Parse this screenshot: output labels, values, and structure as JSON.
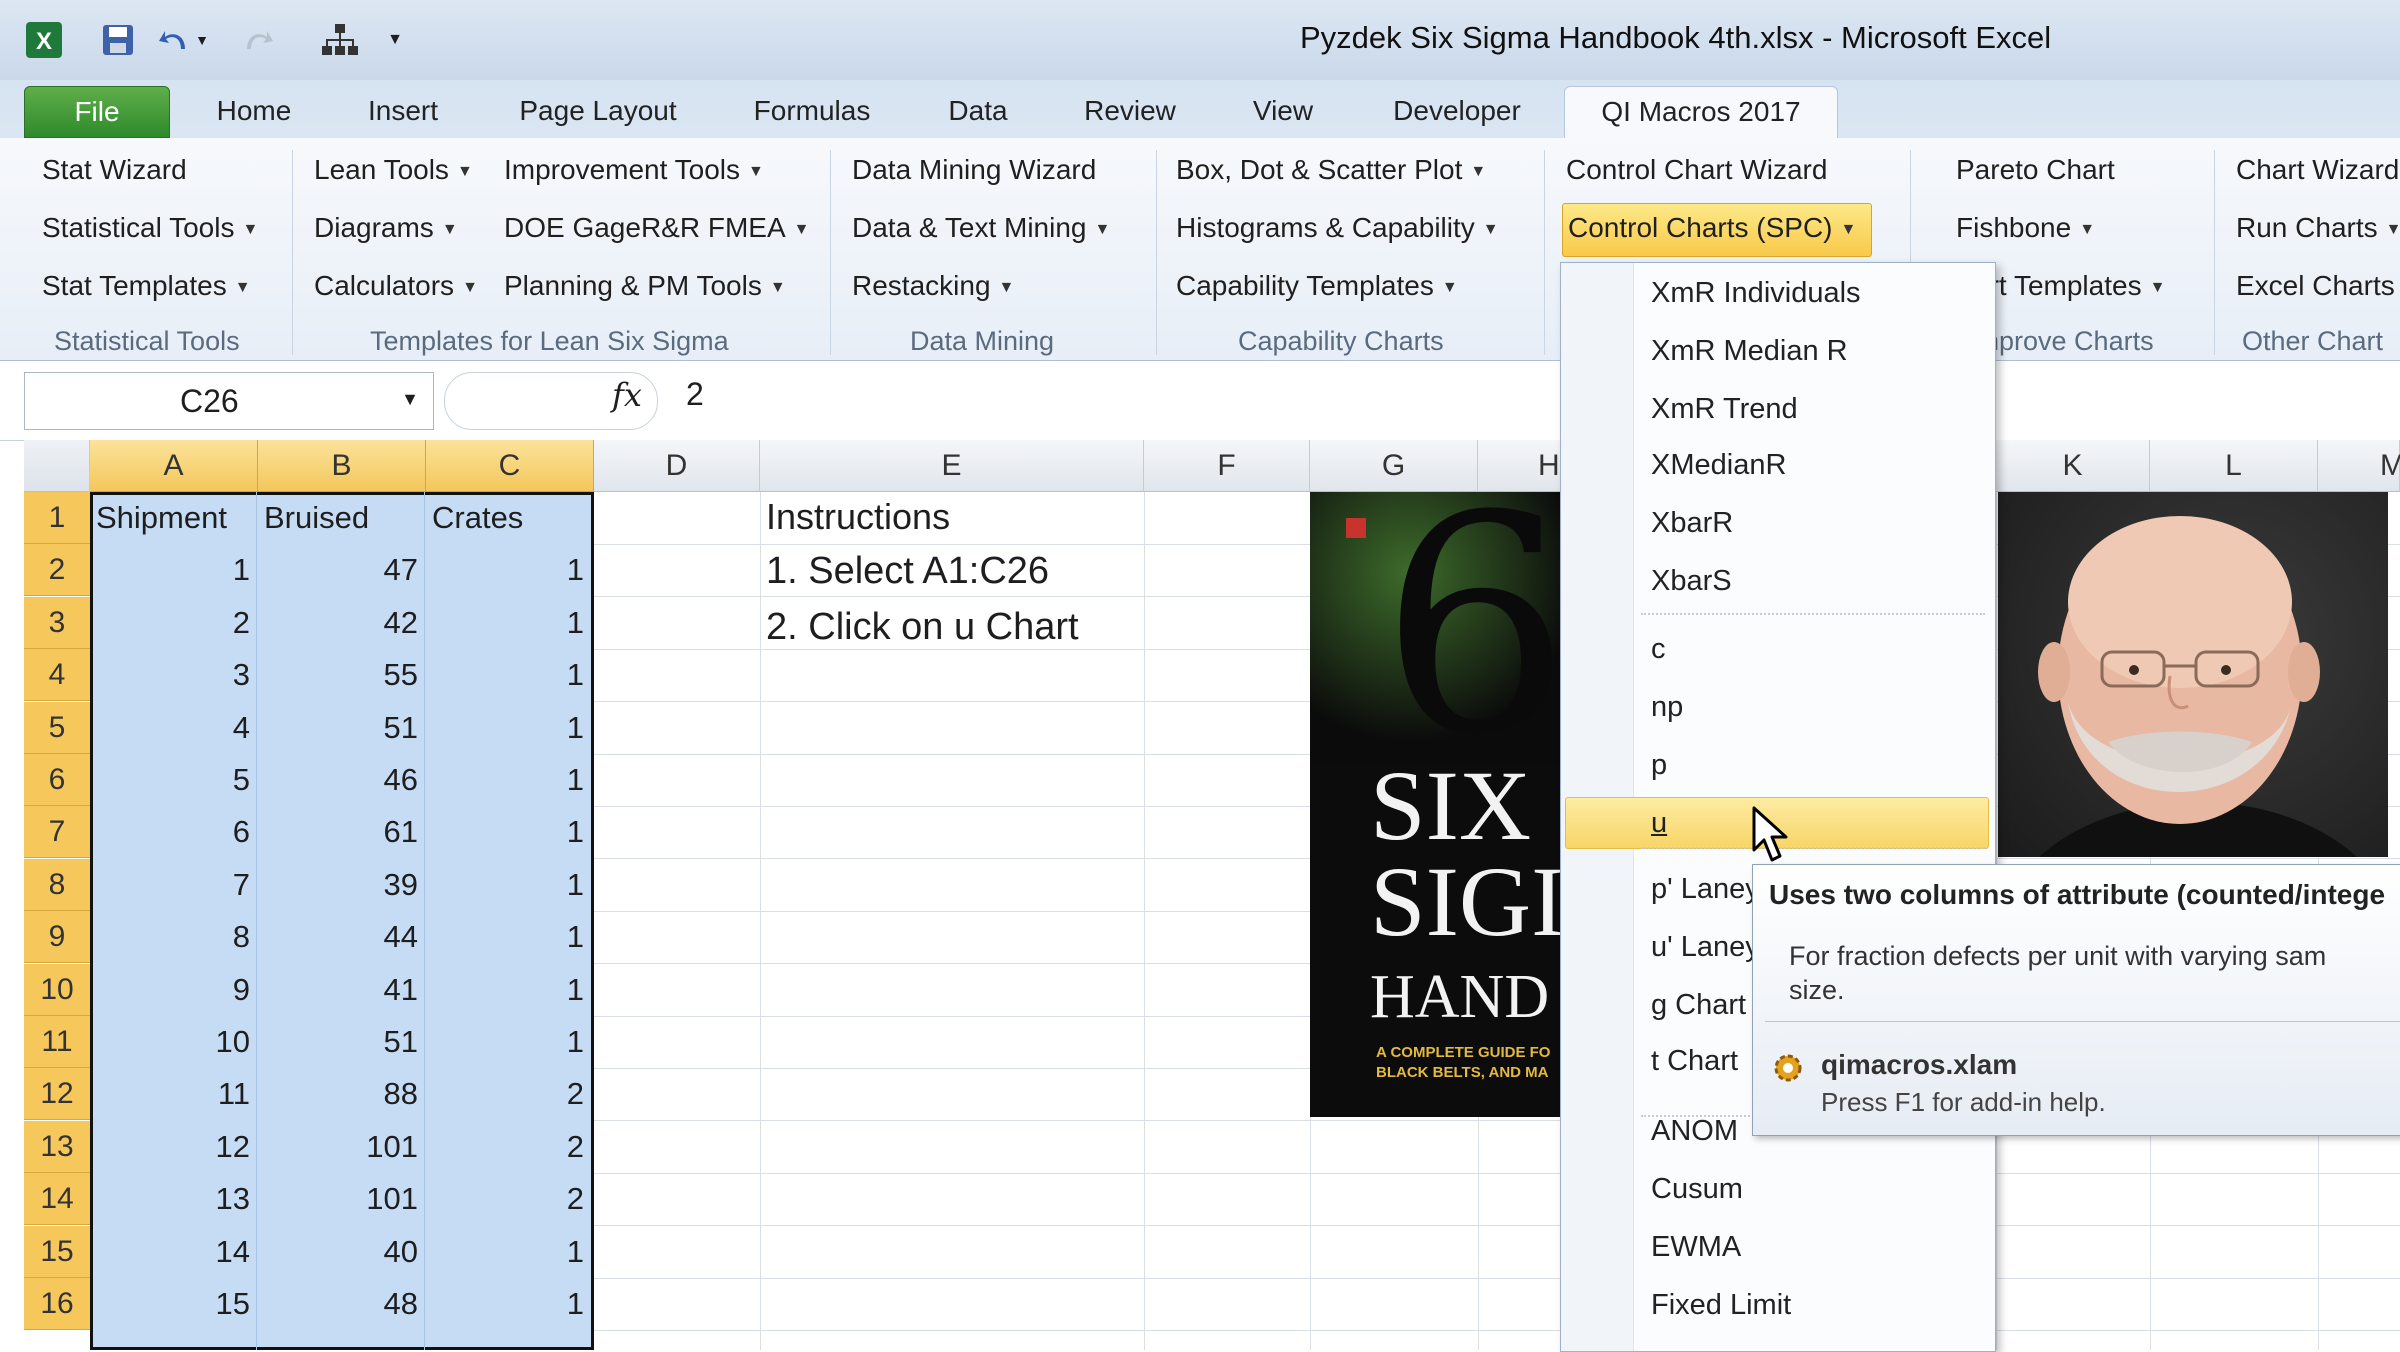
{
  "window": {
    "title": "Pyzdek Six Sigma Handbook 4th.xlsx  -  Microsoft Excel"
  },
  "tabs": [
    "File",
    "Home",
    "Insert",
    "Page Layout",
    "Formulas",
    "Data",
    "Review",
    "View",
    "Developer",
    "QI Macros 2017"
  ],
  "ribbon": {
    "statistical_tools": {
      "items": [
        "Stat Wizard",
        "Statistical Tools",
        "Stat Templates"
      ],
      "label": "Statistical Tools"
    },
    "lean": {
      "col1": [
        "Lean Tools",
        "Diagrams",
        "Calculators"
      ],
      "col2": [
        "Improvement Tools",
        "DOE GageR&R FMEA",
        "Planning & PM Tools"
      ],
      "label": "Templates for Lean Six Sigma"
    },
    "data_mining": {
      "items": [
        "Data Mining Wizard",
        "Data & Text Mining",
        "Restacking"
      ],
      "label": "Data Mining"
    },
    "capability": {
      "items": [
        "Box, Dot & Scatter Plot",
        "Histograms & Capability",
        "Capability Templates"
      ],
      "label": "Capability Charts"
    },
    "control": {
      "items": [
        "Control Chart Wizard",
        "Control Charts (SPC)"
      ]
    },
    "improve": {
      "items": [
        "Pareto Chart",
        "Fishbone",
        "art Templates"
      ],
      "label": "nprove Charts"
    },
    "other": {
      "items": [
        "Chart Wizard",
        "Run Charts",
        "Excel Charts"
      ],
      "label": "Other Chart"
    }
  },
  "formula_bar": {
    "name_box": "C26",
    "fx": "fx",
    "value": "2"
  },
  "columns": [
    "A",
    "B",
    "C",
    "D",
    "E",
    "F",
    "G",
    "H",
    "K",
    "L",
    "M"
  ],
  "sheet": {
    "headers": [
      "Shipment",
      "Bruised",
      "Crates"
    ],
    "rows": [
      {
        "r": "1"
      },
      {
        "r": "2",
        "a": "1",
        "b": "47",
        "c": "1"
      },
      {
        "r": "3",
        "a": "2",
        "b": "42",
        "c": "1"
      },
      {
        "r": "4",
        "a": "3",
        "b": "55",
        "c": "1"
      },
      {
        "r": "5",
        "a": "4",
        "b": "51",
        "c": "1"
      },
      {
        "r": "6",
        "a": "5",
        "b": "46",
        "c": "1"
      },
      {
        "r": "7",
        "a": "6",
        "b": "61",
        "c": "1"
      },
      {
        "r": "8",
        "a": "7",
        "b": "39",
        "c": "1"
      },
      {
        "r": "9",
        "a": "8",
        "b": "44",
        "c": "1"
      },
      {
        "r": "10",
        "a": "9",
        "b": "41",
        "c": "1"
      },
      {
        "r": "11",
        "a": "10",
        "b": "51",
        "c": "1"
      },
      {
        "r": "12",
        "a": "11",
        "b": "88",
        "c": "2"
      },
      {
        "r": "13",
        "a": "12",
        "b": "101",
        "c": "2"
      },
      {
        "r": "14",
        "a": "13",
        "b": "101",
        "c": "2"
      },
      {
        "r": "15",
        "a": "14",
        "b": "40",
        "c": "1"
      },
      {
        "r": "16",
        "a": "15",
        "b": "48",
        "c": "1"
      }
    ],
    "instructions": [
      "Instructions",
      "1. Select A1:C26",
      "2. Click on u Chart"
    ]
  },
  "book": {
    "numeral": "6",
    "line1": "SIX",
    "line2": "SIGI",
    "line3": "HAND",
    "sub1": "A COMPLETE GUIDE FO",
    "sub2": "BLACK BELTS, AND MA"
  },
  "menu": {
    "items": [
      "XmR Individuals",
      "XmR Median R",
      "XmR Trend",
      "XMedianR",
      "XbarR",
      "XbarS",
      "c",
      "np",
      "p",
      "u",
      "p' Laney",
      "u' Laney",
      "g Chart",
      "t Chart",
      "ANOM",
      "Cusum",
      "EWMA",
      "Fixed Limit"
    ]
  },
  "tooltip": {
    "title": "Uses two columns of attribute (counted/intege",
    "body": "For fraction defects per unit with varying sam size.",
    "addin": "qimacros.xlam",
    "help": "Press F1 for add-in help."
  },
  "colors": {
    "selection": "#c6dcf5",
    "header_highlight": "#f6c85b",
    "file_tab": "#2f8a2b",
    "menu_hover": "#f8d567"
  }
}
